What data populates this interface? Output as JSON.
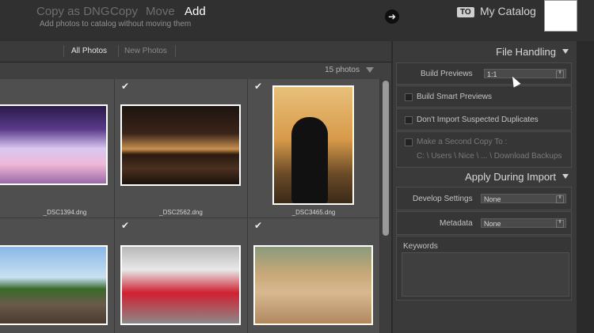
{
  "modes": {
    "copy_dng": "Copy as DNG",
    "copy": "Copy",
    "move": "Move",
    "add": "Add",
    "subtitle": "Add photos to catalog without moving them"
  },
  "destination": {
    "to_badge": "TO",
    "catalog": "My Catalog"
  },
  "grid_tabs": {
    "all": "All Photos",
    "new": "New Photos"
  },
  "photo_count": "15 photos",
  "photos": [
    {
      "name": "_DSC1394.dng"
    },
    {
      "name": "_DSC2562.dng"
    },
    {
      "name": "_DSC3465.dng"
    }
  ],
  "file_handling": {
    "title": "File Handling",
    "build_previews_label": "Build Previews",
    "build_previews_value": "1:1",
    "smart_previews": "Build Smart Previews",
    "no_duplicates": "Don't Import Suspected Duplicates",
    "second_copy": "Make a Second Copy To :",
    "second_copy_path": "C: \\ Users \\ Nice \\ ... \\ Download Backups"
  },
  "apply_during_import": {
    "title": "Apply During Import",
    "develop_label": "Develop Settings",
    "develop_value": "None",
    "metadata_label": "Metadata",
    "metadata_value": "None",
    "keywords_label": "Keywords"
  },
  "colors": {
    "active_text": "#ffffff",
    "inactive_text": "#6e6e6e",
    "panel_bg": "#3a3a3a"
  },
  "icons": [
    "arrow-right-icon",
    "checkmark-icon",
    "triangle-down-icon",
    "cursor-icon"
  ]
}
